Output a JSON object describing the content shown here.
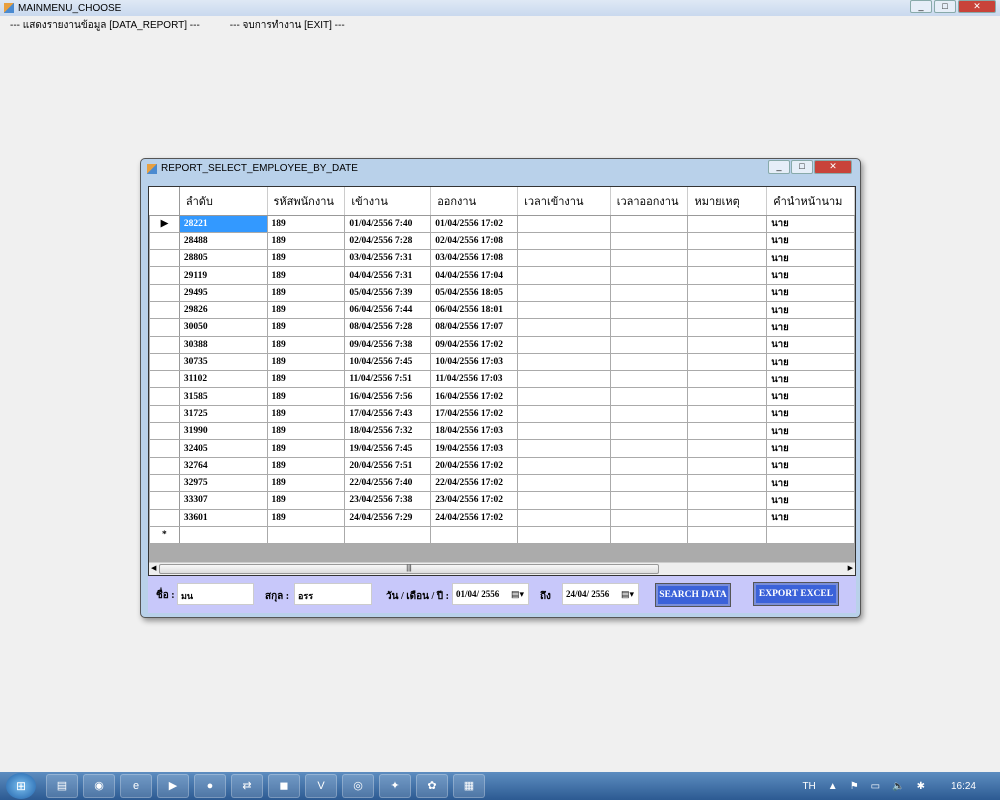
{
  "main_window": {
    "title": "MAINMENU_CHOOSE",
    "menu": [
      "--- แสดงรายงานข้อมูล [DATA_REPORT] ---",
      "--- จบการทำงาน [EXIT] ---"
    ]
  },
  "dialog": {
    "title": "REPORT_SELECT_EMPLOYEE_BY_DATE",
    "columns": [
      "ลำดับ",
      "รหัสพนักงาน",
      "เข้างาน",
      "ออกงาน",
      "เวลาเข้างาน",
      "เวลาออกงาน",
      "หมายเหตุ",
      "คำนำหน้านาม"
    ],
    "rows": [
      [
        "28221",
        "189",
        "01/04/2556 7:40",
        "01/04/2556 17:02",
        "",
        "",
        "",
        "นาย"
      ],
      [
        "28488",
        "189",
        "02/04/2556 7:28",
        "02/04/2556 17:08",
        "",
        "",
        "",
        "นาย"
      ],
      [
        "28805",
        "189",
        "03/04/2556 7:31",
        "03/04/2556 17:08",
        "",
        "",
        "",
        "นาย"
      ],
      [
        "29119",
        "189",
        "04/04/2556 7:31",
        "04/04/2556 17:04",
        "",
        "",
        "",
        "นาย"
      ],
      [
        "29495",
        "189",
        "05/04/2556 7:39",
        "05/04/2556 18:05",
        "",
        "",
        "",
        "นาย"
      ],
      [
        "29826",
        "189",
        "06/04/2556 7:44",
        "06/04/2556 18:01",
        "",
        "",
        "",
        "นาย"
      ],
      [
        "30050",
        "189",
        "08/04/2556 7:28",
        "08/04/2556 17:07",
        "",
        "",
        "",
        "นาย"
      ],
      [
        "30388",
        "189",
        "09/04/2556 7:38",
        "09/04/2556 17:02",
        "",
        "",
        "",
        "นาย"
      ],
      [
        "30735",
        "189",
        "10/04/2556 7:45",
        "10/04/2556 17:03",
        "",
        "",
        "",
        "นาย"
      ],
      [
        "31102",
        "189",
        "11/04/2556 7:51",
        "11/04/2556 17:03",
        "",
        "",
        "",
        "นาย"
      ],
      [
        "31585",
        "189",
        "16/04/2556 7:56",
        "16/04/2556 17:02",
        "",
        "",
        "",
        "นาย"
      ],
      [
        "31725",
        "189",
        "17/04/2556 7:43",
        "17/04/2556 17:02",
        "",
        "",
        "",
        "นาย"
      ],
      [
        "31990",
        "189",
        "18/04/2556 7:32",
        "18/04/2556 17:03",
        "",
        "",
        "",
        "นาย"
      ],
      [
        "32405",
        "189",
        "19/04/2556 7:45",
        "19/04/2556 17:03",
        "",
        "",
        "",
        "นาย"
      ],
      [
        "32764",
        "189",
        "20/04/2556 7:51",
        "20/04/2556 17:02",
        "",
        "",
        "",
        "นาย"
      ],
      [
        "32975",
        "189",
        "22/04/2556 7:40",
        "22/04/2556 17:02",
        "",
        "",
        "",
        "นาย"
      ],
      [
        "33307",
        "189",
        "23/04/2556 7:38",
        "23/04/2556 17:02",
        "",
        "",
        "",
        "นาย"
      ],
      [
        "33601",
        "189",
        "24/04/2556 7:29",
        "24/04/2556 17:02",
        "",
        "",
        "",
        "นาย"
      ]
    ],
    "new_row_marker": "*",
    "current_row_marker": "▶",
    "filters": {
      "name_label": "ชื่อ :",
      "name_value": "มน",
      "surname_label": "สกุล :",
      "surname_value": "อรร",
      "date_label": "วัน / เดือน / ปี :",
      "date_from": "01/04/  2556",
      "to_label": "ถึง",
      "date_to": "24/04/  2556"
    },
    "search_button": "SEARCH DATA",
    "export_button": "EXPORT EXCEL"
  },
  "taskbar": {
    "language": "TH",
    "clock": "16:24"
  }
}
